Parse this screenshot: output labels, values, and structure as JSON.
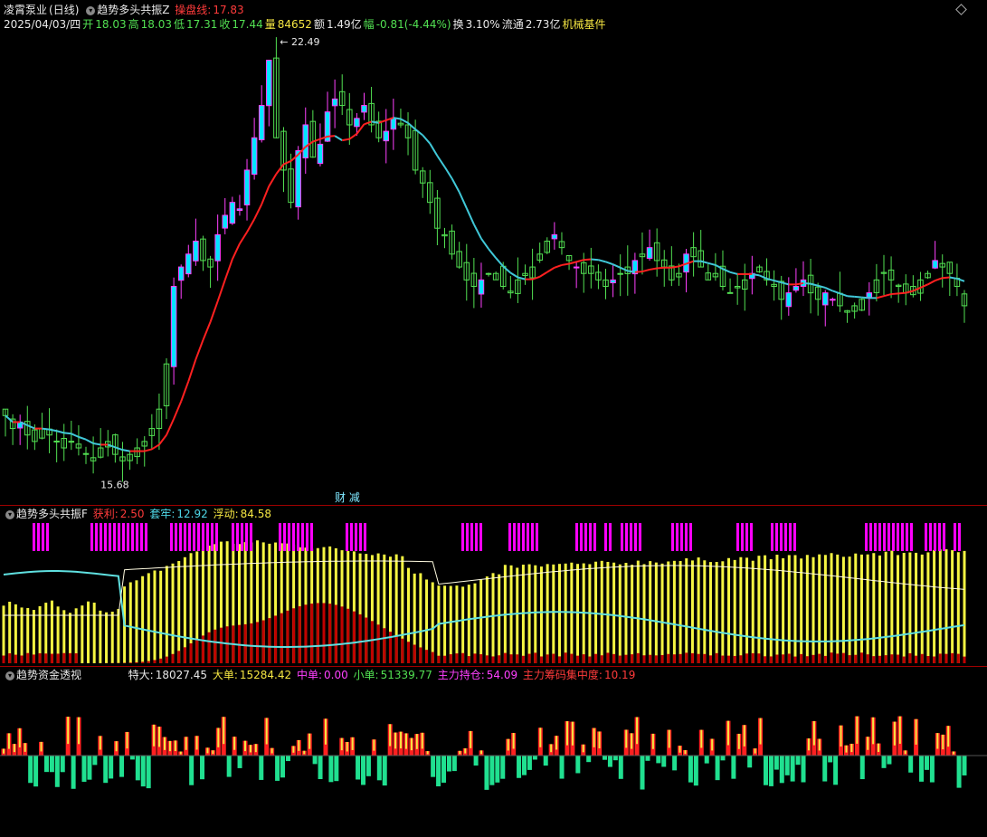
{
  "main": {
    "stock_name": "凌霄泵业",
    "period": "(日线)",
    "indicator_name": "趋势多头共振Z",
    "op_line_label": "操盘线:",
    "op_line_value": "17.83",
    "date": "2025/04/03/四",
    "open_label": "开",
    "open": "18.03",
    "high_label": "高",
    "high": "18.03",
    "low_label": "低",
    "low": "17.31",
    "close_label": "收",
    "close": "17.44",
    "vol_label": "量",
    "vol": "84652",
    "amount_label": "额",
    "amount": "1.49亿",
    "change_label": "幅",
    "change": "-0.81(-4.44%)",
    "turnover_label": "换",
    "turnover": "3.10%",
    "float_label": "流通",
    "float": "2.73亿",
    "sector": "机械基件",
    "max_label": "22.49",
    "min_label": "15.68",
    "center_label": "财 减"
  },
  "panel2": {
    "title": "趋势多头共振F",
    "profit_label": "获利:",
    "profit": "2.50",
    "trapped_label": "套牢:",
    "trapped": "12.92",
    "float_label": "浮动:",
    "float": "84.58"
  },
  "panel3": {
    "title": "趋势资金透视",
    "xl_label": "特大:",
    "xl": "18027.45",
    "l_label": "大单:",
    "l": "15284.42",
    "m_label": "中单:",
    "m": "0.00",
    "s_label": "小单:",
    "s": "51339.77",
    "main_pos_label": "主力持仓:",
    "main_pos": "54.09",
    "conc_label": "主力筹码集中度:",
    "conc": "10.19"
  },
  "colors": {
    "up_candle": "#ff40ff",
    "up_fill": "#00e5ff",
    "down_candle": "#52e052",
    "signal": "#f08080",
    "ma_up": "#ff2020",
    "ma_down": "#40c8d8",
    "bar_yellow": "#f5f542",
    "bar_red": "#c00000",
    "bar_magenta": "#ff00ff",
    "money_up": "#ff2020",
    "money_down": "#20e090"
  },
  "chart_data": [
    {
      "type": "candlestick",
      "title": "凌霄泵业 (日线)",
      "ylim": [
        15.5,
        22.6
      ],
      "price_path": [
        16.7,
        16.5,
        16.6,
        16.4,
        16.3,
        16.5,
        16.4,
        16.3,
        16.2,
        16.3,
        16.2,
        16.1,
        16.0,
        16.2,
        16.3,
        16.1,
        16.0,
        16.1,
        16.2,
        16.3,
        16.5,
        16.8,
        17.5,
        18.7,
        19.0,
        19.2,
        19.4,
        19.1,
        19.0,
        19.5,
        19.8,
        20.0,
        19.9,
        20.5,
        21.0,
        21.5,
        22.2,
        21.0,
        20.5,
        20.0,
        20.8,
        21.2,
        20.7,
        20.9,
        21.4,
        21.6,
        21.5,
        21.2,
        21.3,
        21.5,
        21.2,
        21.0,
        21.1,
        21.3,
        21.2,
        21.0,
        20.5,
        20.3,
        20.0,
        19.6,
        19.5,
        19.2,
        19.0,
        18.8,
        18.7,
        18.8,
        18.9,
        18.9,
        18.7,
        18.6,
        18.8,
        18.9,
        19.0,
        19.2,
        19.4,
        19.5,
        19.3,
        19.1,
        19.0,
        18.9,
        18.9,
        18.8,
        18.7,
        18.8,
        18.9,
        19.0,
        19.1,
        19.2,
        19.3,
        19.1,
        19.0,
        18.8,
        18.9,
        19.2,
        19.3,
        19.0,
        18.8,
        18.9,
        18.7,
        18.6,
        18.7,
        18.8,
        18.9,
        19.0,
        18.8,
        18.7,
        18.5,
        18.6,
        18.7,
        18.8,
        18.6,
        18.5,
        18.6,
        18.5,
        18.4,
        18.3,
        18.4,
        18.5,
        18.6,
        18.8,
        18.9,
        18.8,
        18.7,
        18.6,
        18.7,
        18.8,
        18.9,
        19.1,
        19.0,
        18.9,
        18.7,
        18.4
      ]
    },
    {
      "type": "bar",
      "title": "趋势多头共振F",
      "series": [
        {
          "name": "获利",
          "last": 2.5
        },
        {
          "name": "套牢",
          "last": 12.92
        },
        {
          "name": "浮动",
          "last": 84.58
        }
      ]
    },
    {
      "type": "bar",
      "title": "趋势资金透视",
      "series": [
        {
          "name": "特大",
          "last": 18027.45
        },
        {
          "name": "大单",
          "last": 15284.42
        },
        {
          "name": "中单",
          "last": 0.0
        },
        {
          "name": "小单",
          "last": 51339.77
        },
        {
          "name": "主力持仓",
          "last": 54.09
        },
        {
          "name": "主力筹码集中度",
          "last": 10.19
        }
      ]
    }
  ]
}
